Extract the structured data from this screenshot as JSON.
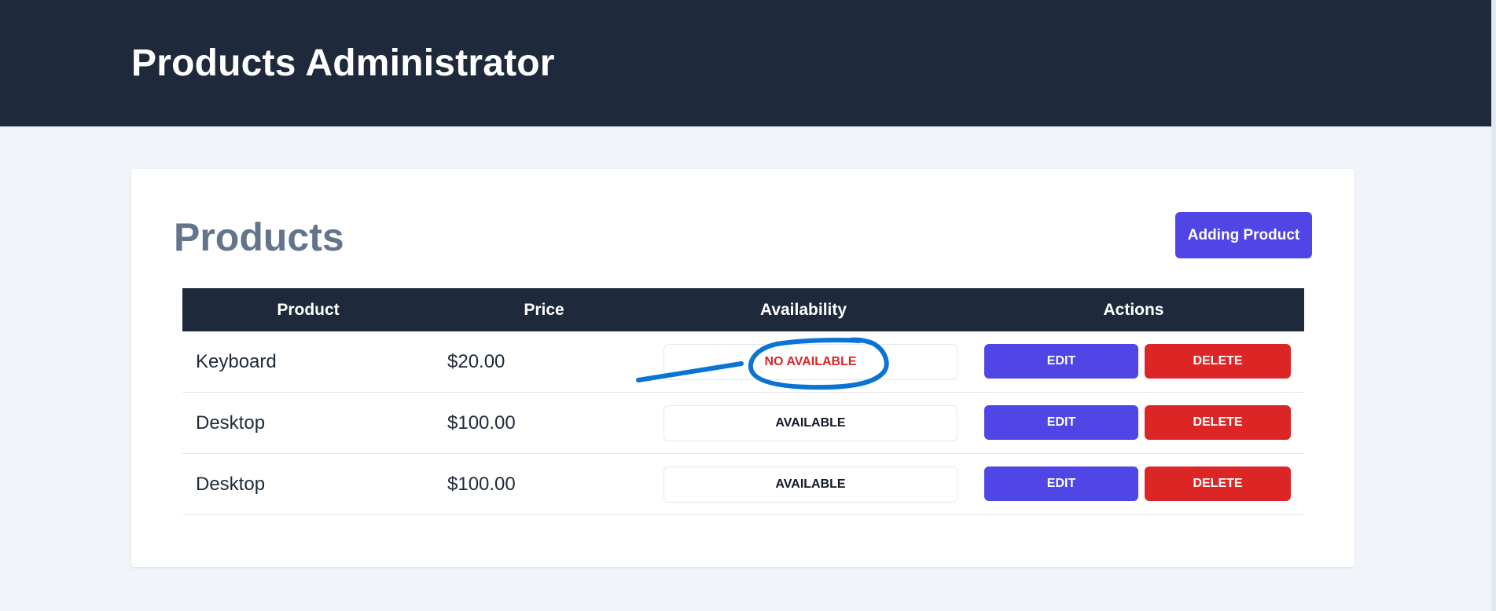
{
  "header": {
    "title": "Products Administrator"
  },
  "card": {
    "title": "Products",
    "add_button_label": "Adding Product"
  },
  "table": {
    "columns": [
      "Product",
      "Price",
      "Availability",
      "Actions"
    ],
    "rows": [
      {
        "product": "Keyboard",
        "price": "$20.00",
        "availability": "NO AVAILABLE",
        "edit": "EDIT",
        "delete": "DELETE"
      },
      {
        "product": "Desktop",
        "price": "$100.00",
        "availability": "AVAILABLE",
        "edit": "EDIT",
        "delete": "DELETE"
      },
      {
        "product": "Desktop",
        "price": "$100.00",
        "availability": "AVAILABLE",
        "edit": "EDIT",
        "delete": "DELETE"
      }
    ]
  },
  "colors": {
    "header_bg": "#1e293b",
    "accent": "#4f46e5",
    "danger": "#dc2626",
    "available_text": "#111827",
    "unavailable_text": "#dc2626",
    "annotation": "#0a74d4"
  }
}
